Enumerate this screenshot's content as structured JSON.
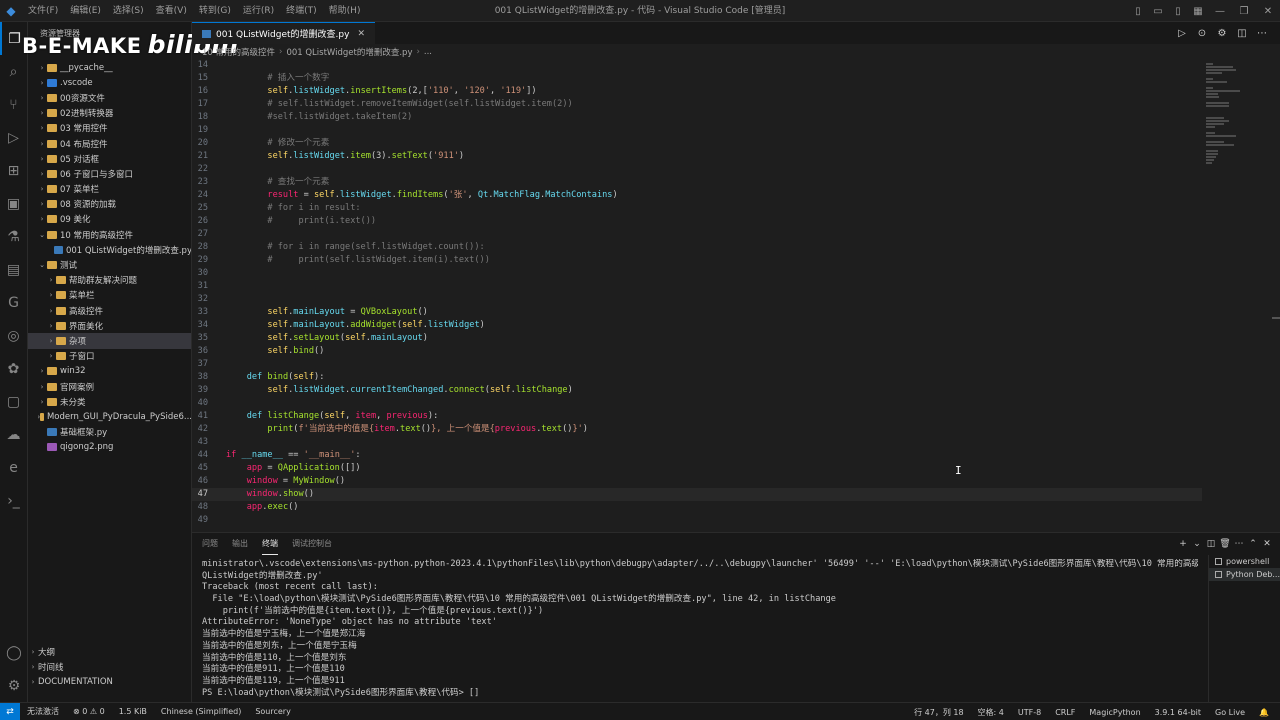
{
  "titlebar": {
    "menu": [
      "文件(F)",
      "编辑(E)",
      "选择(S)",
      "查看(V)",
      "转到(G)",
      "运行(R)",
      "终端(T)",
      "帮助(H)"
    ],
    "title": "001 QListWidget的增删改查.py - 代码 - Visual Studio Code [管理员]"
  },
  "watermark": {
    "text": "B-E-MAKE",
    "logo": "bilibili"
  },
  "sidebar": {
    "header": "资源管理器",
    "items": [
      {
        "label": "__pycache__",
        "type": "folder",
        "depth": 1
      },
      {
        "label": ".vscode",
        "type": "vs",
        "depth": 1
      },
      {
        "label": "00资源文件",
        "type": "folder",
        "depth": 1
      },
      {
        "label": "02进制转换器",
        "type": "folder",
        "depth": 1
      },
      {
        "label": "03 常用控件",
        "type": "folder",
        "depth": 1
      },
      {
        "label": "04 布局控件",
        "type": "folder",
        "depth": 1
      },
      {
        "label": "05 对话框",
        "type": "folder",
        "depth": 1
      },
      {
        "label": "06 子窗口与多窗口",
        "type": "folder",
        "depth": 1
      },
      {
        "label": "07 菜单栏",
        "type": "folder",
        "depth": 1
      },
      {
        "label": "08 资源的加载",
        "type": "folder",
        "depth": 1
      },
      {
        "label": "09 美化",
        "type": "folder",
        "depth": 1
      },
      {
        "label": "10 常用的高级控件",
        "type": "folder",
        "depth": 1,
        "open": true
      },
      {
        "label": "001 QListWidget的增删改查.py",
        "type": "py",
        "depth": 2
      },
      {
        "label": "测试",
        "type": "folder",
        "depth": 1,
        "open": true
      },
      {
        "label": "帮助群友解决问题",
        "type": "folder",
        "depth": 2
      },
      {
        "label": "菜单栏",
        "type": "folder",
        "depth": 2
      },
      {
        "label": "高级控件",
        "type": "folder",
        "depth": 2
      },
      {
        "label": "界面美化",
        "type": "folder",
        "depth": 2
      },
      {
        "label": "杂项",
        "type": "folder",
        "depth": 2,
        "selected": true
      },
      {
        "label": "子窗口",
        "type": "folder",
        "depth": 2
      },
      {
        "label": "win32",
        "type": "folder",
        "depth": 1
      },
      {
        "label": "官网案例",
        "type": "folder",
        "depth": 1
      },
      {
        "label": "未分类",
        "type": "folder",
        "depth": 1
      },
      {
        "label": "Modern_GUI_PyDracula_PySide6...",
        "type": "folder",
        "depth": 1
      },
      {
        "label": "基础框架.py",
        "type": "py",
        "depth": 1
      },
      {
        "label": "qigong2.png",
        "type": "png",
        "depth": 1
      }
    ],
    "outline": [
      "大纲",
      "时间线",
      "DOCUMENTATION"
    ]
  },
  "tab": {
    "label": "001 QListWidget的增删改查.py"
  },
  "breadcrumb": [
    "10 常用的高级控件",
    "001 QListWidget的增删改查.py",
    "..."
  ],
  "code": [
    {
      "n": "14",
      "html": ""
    },
    {
      "n": "15",
      "html": "        <span class='t-cm'># 插入一个数字</span>"
    },
    {
      "n": "16",
      "html": "        <span class='t-self'>self</span>.<span class='t-cls'>listWidget</span>.<span class='t-fn'>insertItems</span>(2,[<span class='t-str'>'110'</span>, <span class='t-str'>'120'</span>, <span class='t-str'>'119'</span>])"
    },
    {
      "n": "17",
      "html": "        <span class='t-cm'># self.listWidget.removeItemWidget(self.listWidget.item(2))</span>"
    },
    {
      "n": "18",
      "html": "        <span class='t-cm'>#self.listWidget.takeItem(2)</span>"
    },
    {
      "n": "19",
      "html": ""
    },
    {
      "n": "20",
      "html": "        <span class='t-cm'># 修改一个元素</span>"
    },
    {
      "n": "21",
      "html": "        <span class='t-self'>self</span>.<span class='t-cls'>listWidget</span>.<span class='t-fn'>item</span>(3).<span class='t-fn'>setText</span>(<span class='t-str'>'911'</span>)"
    },
    {
      "n": "22",
      "html": ""
    },
    {
      "n": "23",
      "html": "        <span class='t-cm'># 查找一个元素</span>"
    },
    {
      "n": "24",
      "html": "        <span class='t-kw'>result</span> = <span class='t-self'>self</span>.<span class='t-cls'>listWidget</span>.<span class='t-fn'>findItems</span>(<span class='t-str'>'张'</span>, <span class='t-cls'>Qt</span>.<span class='t-cls'>MatchFlag</span>.<span class='t-cls'>MatchContains</span>)"
    },
    {
      "n": "25",
      "html": "        <span class='t-cm'># for i in result:</span>"
    },
    {
      "n": "26",
      "html": "        <span class='t-cm'>#     print(i.text())</span>"
    },
    {
      "n": "27",
      "html": ""
    },
    {
      "n": "28",
      "html": "        <span class='t-cm'># for i in range(self.listWidget.count()):</span>"
    },
    {
      "n": "29",
      "html": "        <span class='t-cm'>#     print(self.listWidget.item(i).text())</span>"
    },
    {
      "n": "30",
      "html": ""
    },
    {
      "n": "31",
      "html": ""
    },
    {
      "n": "32",
      "html": ""
    },
    {
      "n": "33",
      "html": "        <span class='t-self'>self</span>.<span class='t-cls'>mainLayout</span> = <span class='t-fn'>QVBoxLayout</span>()"
    },
    {
      "n": "34",
      "html": "        <span class='t-self'>self</span>.<span class='t-cls'>mainLayout</span>.<span class='t-fn'>addWidget</span>(<span class='t-self'>self</span>.<span class='t-cls'>listWidget</span>)"
    },
    {
      "n": "35",
      "html": "        <span class='t-self'>self</span>.<span class='t-fn'>setLayout</span>(<span class='t-self'>self</span>.<span class='t-cls'>mainLayout</span>)"
    },
    {
      "n": "36",
      "html": "        <span class='t-self'>self</span>.<span class='t-fn'>bind</span>()"
    },
    {
      "n": "37",
      "html": ""
    },
    {
      "n": "38",
      "html": "    <span class='t-cls'>def</span> <span class='t-fn'>bind</span>(<span class='t-self'>self</span>):"
    },
    {
      "n": "39",
      "html": "        <span class='t-self'>self</span>.<span class='t-cls'>listWidget</span>.<span class='t-cls'>currentItemChanged</span>.<span class='t-fn'>connect</span>(<span class='t-self'>self</span>.<span class='t-fn'>listChange</span>)"
    },
    {
      "n": "40",
      "html": ""
    },
    {
      "n": "41",
      "html": "    <span class='t-cls'>def</span> <span class='t-fn'>listChange</span>(<span class='t-self'>self</span>, <span class='t-kw'>item</span>, <span class='t-kw'>previous</span>):"
    },
    {
      "n": "42",
      "html": "        <span class='t-fn'>print</span>(<span class='t-str'>f'当前选中的值是{</span><span class='t-kw'>item</span>.<span class='t-fn'>text</span>()<span class='t-str'>}, 上一个值是{</span><span class='t-kw'>previous</span>.<span class='t-fn'>text</span>()<span class='t-str'>}'</span>)"
    },
    {
      "n": "43",
      "html": ""
    },
    {
      "n": "44",
      "html": "<span class='t-kw'>if</span> <span class='t-cls'>__name__</span> == <span class='t-str'>'__main__'</span>:"
    },
    {
      "n": "45",
      "html": "    <span class='t-kw'>app</span> = <span class='t-fn'>QApplication</span>([])"
    },
    {
      "n": "46",
      "html": "    <span class='t-kw'>window</span> = <span class='t-fn'>MyWindow</span>()"
    },
    {
      "n": "47",
      "html": "    <span class='t-kw'>window</span>.<span class='t-fn'>show</span>()",
      "current": true
    },
    {
      "n": "48",
      "html": "    <span class='t-kw'>app</span>.<span class='t-fn'>exec</span>()"
    },
    {
      "n": "49",
      "html": ""
    }
  ],
  "panel": {
    "tabs": [
      "问题",
      "输出",
      "终端",
      "调试控制台"
    ],
    "active_tab": 2,
    "terminal_lines": [
      "ministrator\\.vscode\\extensions\\ms-python.python-2023.4.1\\pythonFiles\\lib\\python\\debugpy\\adapter/../..\\debugpy\\launcher' '56499' '--' 'E:\\load\\python\\模块测试\\PySide6图形界面库\\教程\\代码\\10 常用的高级控件\\001",
      "QListWidget的增删改查.py'",
      "Traceback (most recent call last):",
      "  File \"E:\\load\\python\\模块测试\\PySide6图形界面库\\教程\\代码\\10 常用的高级控件\\001 QListWidget的增删改查.py\", line 42, in listChange",
      "    print(f'当前选中的值是{item.text()}, 上一个值是{previous.text()}')",
      "AttributeError: 'NoneType' object has no attribute 'text'",
      "当前选中的值是宁玉梅，上一个值是郑江海",
      "当前选中的值是刘东，上一个值是宁玉梅",
      "当前选中的值是110，上一个值是刘东",
      "当前选中的值是911，上一个值是110",
      "当前选中的值是119，上一个值是911",
      "PS E:\\load\\python\\模块测试\\PySide6图形界面库\\教程\\代码> []"
    ],
    "terminals": [
      "powershell",
      "Python Deb..."
    ]
  },
  "statusbar": {
    "left": [
      "无法激活",
      "⊗ 0 ⚠ 0",
      "1.5 KiB",
      "Chinese (Simplified)",
      "Sourcery"
    ],
    "right": [
      "行 47，列 18",
      "空格: 4",
      "UTF-8",
      "CRLF",
      "MagicPython",
      "3.9.1 64-bit",
      "Go Live"
    ]
  },
  "colors": {
    "accent": "#0078d4",
    "background": "#1e1e1e",
    "sidebar": "#181818"
  }
}
